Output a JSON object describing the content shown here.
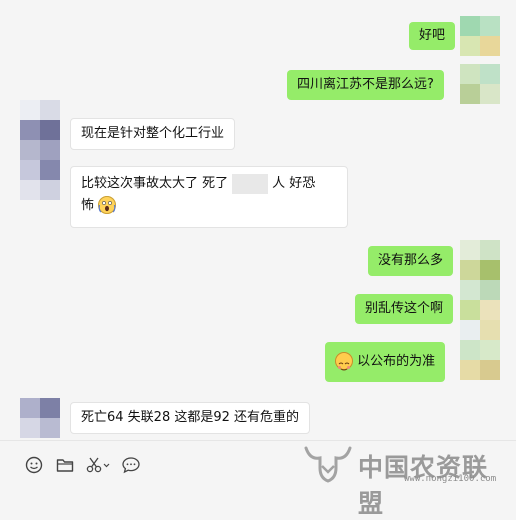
{
  "messages": [
    {
      "id": "m1",
      "side": "out",
      "text": "好吧"
    },
    {
      "id": "m2",
      "side": "out",
      "text": "四川离江苏不是那么远?"
    },
    {
      "id": "m3",
      "side": "in",
      "text": "现在是针对整个化工行业"
    },
    {
      "id": "m4",
      "side": "in",
      "text_a": "比较这次事故太大了    死了",
      "text_b": "人  好恐",
      "text_c": "怖"
    },
    {
      "id": "m5",
      "side": "out",
      "text": "没有那么多"
    },
    {
      "id": "m6",
      "side": "out",
      "text": "别乱传这个啊"
    },
    {
      "id": "m7",
      "side": "out",
      "text": "以公布的为准"
    },
    {
      "id": "m8",
      "side": "in",
      "text": "死亡64   失联28  这都是92  还有危重的"
    }
  ],
  "watermark": {
    "text": "中国农资联盟",
    "url": "www.nongzi100.com"
  },
  "icons": [
    "emoji-icon",
    "folder-icon",
    "scissors-icon",
    "chat-bubble-icon"
  ],
  "colors": {
    "bubble_out": "#95ec69",
    "bubble_in": "#ffffff",
    "background": "#f5f5f5"
  }
}
